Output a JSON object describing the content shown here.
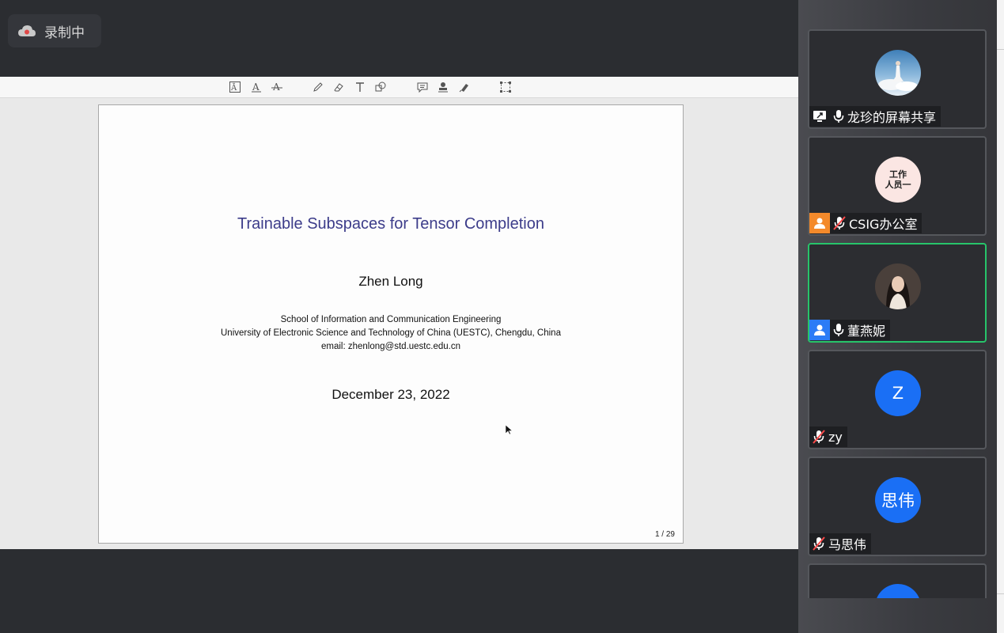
{
  "recording": {
    "label": "录制中"
  },
  "slide": {
    "title": "Trainable Subspaces for Tensor Completion",
    "author": "Zhen Long",
    "affiliation_line1": "School of Information and Communication Engineering",
    "affiliation_line2": "University of Electronic Science and Technology of China (UESTC), Chengdu, China",
    "email": "email:  zhenlong@std.uestc.edu.cn",
    "date": "December 23, 2022",
    "page": "1 / 29"
  },
  "toolbar": {
    "icons": [
      "text-style-icon",
      "font-a-icon",
      "strikethrough-a-icon",
      "pen-icon",
      "eraser-icon",
      "text-tool-icon",
      "shapes-icon",
      "comment-icon",
      "stamp-icon",
      "highlighter-icon",
      "select-region-icon"
    ]
  },
  "participants": [
    {
      "name": "龙珍的屏幕共享",
      "avatar_type": "photo",
      "mic": "on",
      "badge": "screen-share-icon"
    },
    {
      "name": "CSIG办公室",
      "avatar_text": "工作\n人员一",
      "avatar_type": "text",
      "mic": "muted",
      "badge": "person-icon",
      "badge_color": "#f48a2b"
    },
    {
      "name": "董燕妮",
      "avatar_type": "photo",
      "mic": "on",
      "badge": "person-icon",
      "badge_color": "#2c7cf6",
      "active": true
    },
    {
      "name": "zy",
      "avatar_text": "Z",
      "avatar_type": "initial",
      "mic": "muted"
    },
    {
      "name": "马思伟",
      "avatar_text": "思伟",
      "avatar_type": "initial",
      "mic": "muted"
    }
  ],
  "colors": {
    "accent_blue": "#1a6ff5",
    "active_border": "#27c46a",
    "title_color": "#3c3c8a"
  }
}
